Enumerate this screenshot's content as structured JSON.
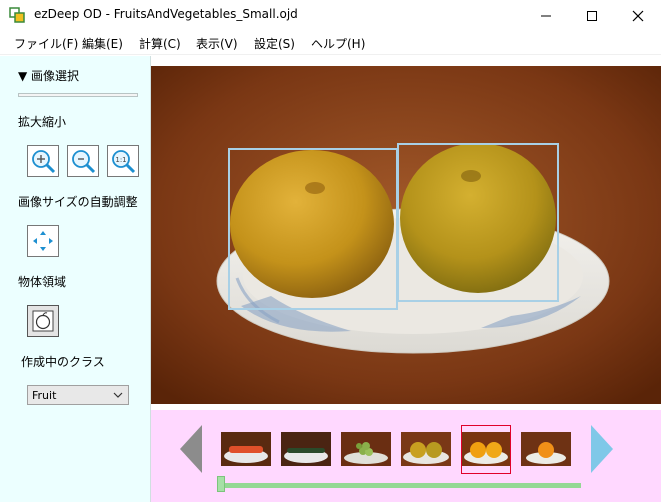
{
  "window": {
    "title": "ezDeep OD - FruitsAndVegetables_Small.ojd"
  },
  "menu": {
    "items": [
      {
        "label": "ファイル(F)"
      },
      {
        "label": "編集(E)"
      },
      {
        "label": "計算(C)"
      },
      {
        "label": "表示(V)"
      },
      {
        "label": "設定(S)"
      },
      {
        "label": "ヘルプ(H)"
      }
    ]
  },
  "sidebar": {
    "section_title": "▼ 画像選択",
    "zoom_label": "拡大縮小",
    "auto_fit_label": "画像サイズの自動調整",
    "region_label": "物体領域",
    "class_label": "作成中のクラス",
    "class_value": "Fruit",
    "icons": {
      "zoom_in": "zoom-in-icon",
      "zoom_out": "zoom-out-icon",
      "zoom_actual": "zoom-actual-size-icon",
      "fit": "fit-to-window-icon",
      "region": "object-region-icon"
    },
    "zoom_actual_text": "1:1"
  },
  "viewer": {
    "image": "two yellow pears on a white plate",
    "boxes": [
      {
        "class": "Fruit"
      },
      {
        "class": "Fruit"
      }
    ]
  },
  "thumbnails": {
    "items": [
      {
        "subject": "carrots",
        "selected": false
      },
      {
        "subject": "cucumber",
        "selected": false
      },
      {
        "subject": "grapes",
        "selected": false
      },
      {
        "subject": "pears",
        "selected": false
      },
      {
        "subject": "oranges",
        "selected": true
      },
      {
        "subject": "orange",
        "selected": false
      }
    ]
  },
  "colors": {
    "sidebar_bg": "#ecffff",
    "strip_bg": "#ffd8ff",
    "bbox": "#a8d0e6",
    "selection": "#e0002a",
    "nav_prev": "#8c8c8c",
    "nav_next": "#7fc8e8"
  }
}
